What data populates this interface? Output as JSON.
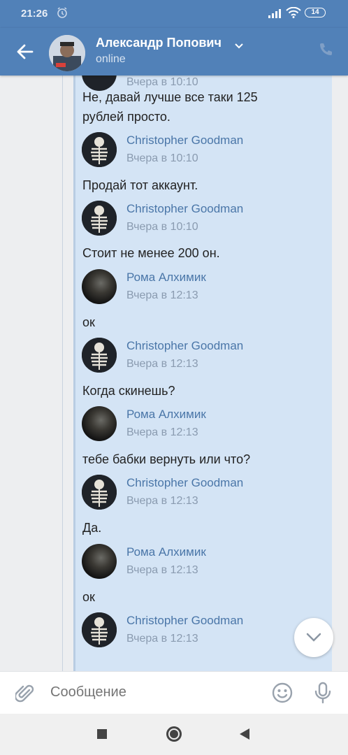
{
  "status_bar": {
    "time": "21:26",
    "battery": "14"
  },
  "header": {
    "name": "Александр Попович",
    "status": "online"
  },
  "partial_top_time": "Вчера в 10:10",
  "messages": [
    {
      "type": "text",
      "text": "Не, давай лучше все таки 125"
    },
    {
      "type": "text",
      "text": "рублей просто."
    },
    {
      "type": "author",
      "name": "Christopher Goodman",
      "time": "Вчера в 10:10"
    },
    {
      "type": "text",
      "text": "Продай тот аккаунт."
    },
    {
      "type": "author",
      "name": "Christopher Goodman",
      "time": "Вчера в 10:10"
    },
    {
      "type": "text",
      "text": "Стоит не менее 200 он."
    },
    {
      "type": "author",
      "name": "Рома Алхимик",
      "time": "Вчера в 12:13"
    },
    {
      "type": "text",
      "text": "ок"
    },
    {
      "type": "author",
      "name": "Christopher Goodman",
      "time": "Вчера в 12:13"
    },
    {
      "type": "text",
      "text": "Когда скинешь?"
    },
    {
      "type": "author",
      "name": "Рома Алхимик",
      "time": "Вчера в 12:13"
    },
    {
      "type": "text",
      "text": "тебе бабки вернуть или что?"
    },
    {
      "type": "author",
      "name": "Christopher Goodman",
      "time": "Вчера в 12:13"
    },
    {
      "type": "text",
      "text": "Да."
    },
    {
      "type": "author",
      "name": "Рома Алхимик",
      "time": "Вчера в 12:13"
    },
    {
      "type": "text",
      "text": "ок"
    },
    {
      "type": "author",
      "name": "Christopher Goodman",
      "time": "Вчера в 12:13"
    }
  ],
  "composer": {
    "placeholder": "Сообщение"
  },
  "colors": {
    "header": "#5181b8",
    "bubble": "#d4e4f5",
    "author_name": "#4a76a8",
    "time": "#8a9bb0"
  },
  "icons": [
    "back-arrow-icon",
    "chevron-down-icon",
    "phone-icon",
    "attach-icon",
    "emoji-icon",
    "mic-icon",
    "chevron-down-icon",
    "alarm-icon",
    "signal-icon",
    "wifi-icon"
  ]
}
